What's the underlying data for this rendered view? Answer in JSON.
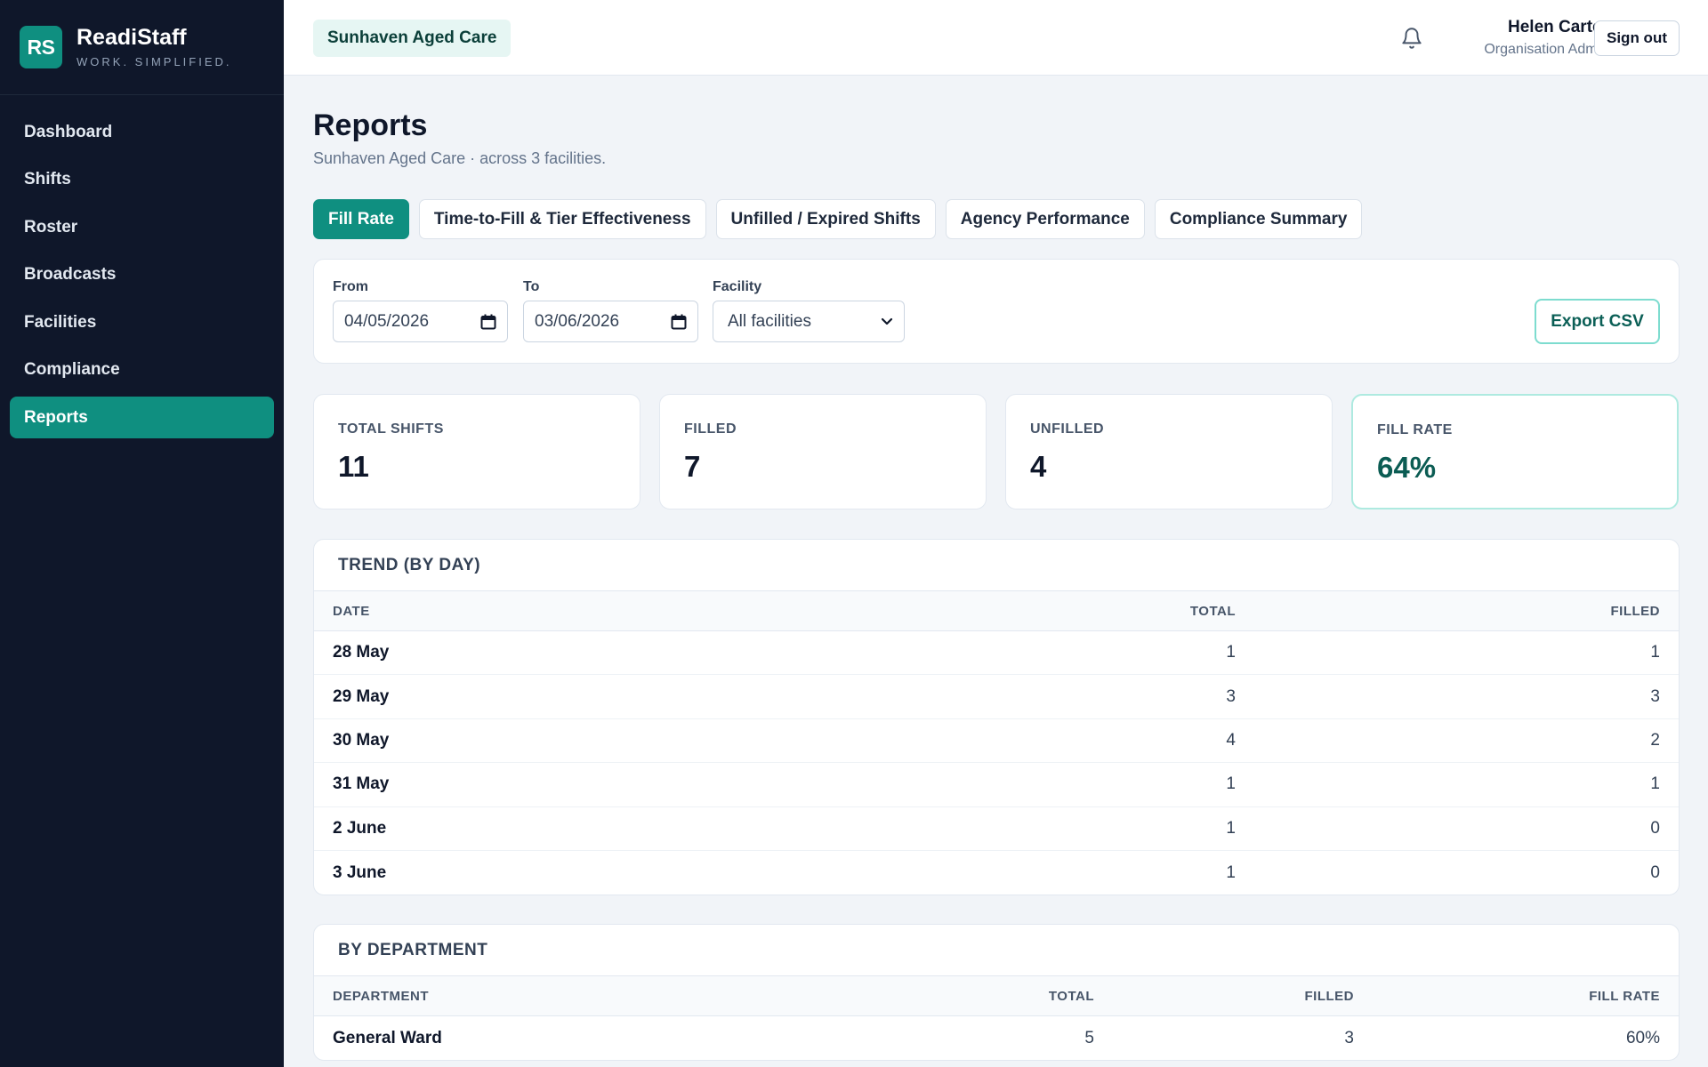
{
  "brand": {
    "logo_text": "RS",
    "name": "ReadiStaff",
    "tagline": "WORK. SIMPLIFIED."
  },
  "nav": {
    "items": [
      {
        "label": "Dashboard",
        "active": false
      },
      {
        "label": "Shifts",
        "active": false
      },
      {
        "label": "Roster",
        "active": false
      },
      {
        "label": "Broadcasts",
        "active": false
      },
      {
        "label": "Facilities",
        "active": false
      },
      {
        "label": "Compliance",
        "active": false
      },
      {
        "label": "Reports",
        "active": true
      }
    ]
  },
  "header": {
    "organisation": "Sunhaven Aged Care",
    "user_name": "Helen Carter",
    "user_role": "Organisation Admin",
    "sign_out_label": "Sign out"
  },
  "page": {
    "title": "Reports",
    "subtitle": "Sunhaven Aged Care · across 3 facilities."
  },
  "tabs": [
    {
      "label": "Fill Rate",
      "active": true
    },
    {
      "label": "Time-to-Fill & Tier Effectiveness",
      "active": false
    },
    {
      "label": "Unfilled / Expired Shifts",
      "active": false
    },
    {
      "label": "Agency Performance",
      "active": false
    },
    {
      "label": "Compliance Summary",
      "active": false
    }
  ],
  "filters": {
    "from_label": "From",
    "from_value": "04/05/2026",
    "to_label": "To",
    "to_value": "03/06/2026",
    "facility_label": "Facility",
    "facility_value": "All facilities",
    "export_label": "Export CSV"
  },
  "stats": [
    {
      "label": "TOTAL SHIFTS",
      "value": "11"
    },
    {
      "label": "FILLED",
      "value": "7"
    },
    {
      "label": "UNFILLED",
      "value": "4"
    },
    {
      "label": "FILL RATE",
      "value": "64%"
    }
  ],
  "trend": {
    "title": "TREND (BY DAY)",
    "headers": {
      "date": "DATE",
      "total": "TOTAL",
      "filled": "FILLED"
    },
    "rows": [
      {
        "date": "28 May",
        "total": "1",
        "filled": "1"
      },
      {
        "date": "29 May",
        "total": "3",
        "filled": "3"
      },
      {
        "date": "30 May",
        "total": "4",
        "filled": "2"
      },
      {
        "date": "31 May",
        "total": "1",
        "filled": "1"
      },
      {
        "date": "2 June",
        "total": "1",
        "filled": "0"
      },
      {
        "date": "3 June",
        "total": "1",
        "filled": "0"
      }
    ]
  },
  "department": {
    "title": "BY DEPARTMENT",
    "headers": {
      "department": "DEPARTMENT",
      "total": "TOTAL",
      "filled": "FILLED",
      "fill_rate": "FILL RATE"
    },
    "rows": [
      {
        "department": "General Ward",
        "total": "5",
        "filled": "3",
        "fill_rate": "60%"
      }
    ]
  },
  "colors": {
    "sidebar_bg": "#0f172a",
    "accent": "#0f8f80",
    "page_bg": "#f1f4f8"
  }
}
